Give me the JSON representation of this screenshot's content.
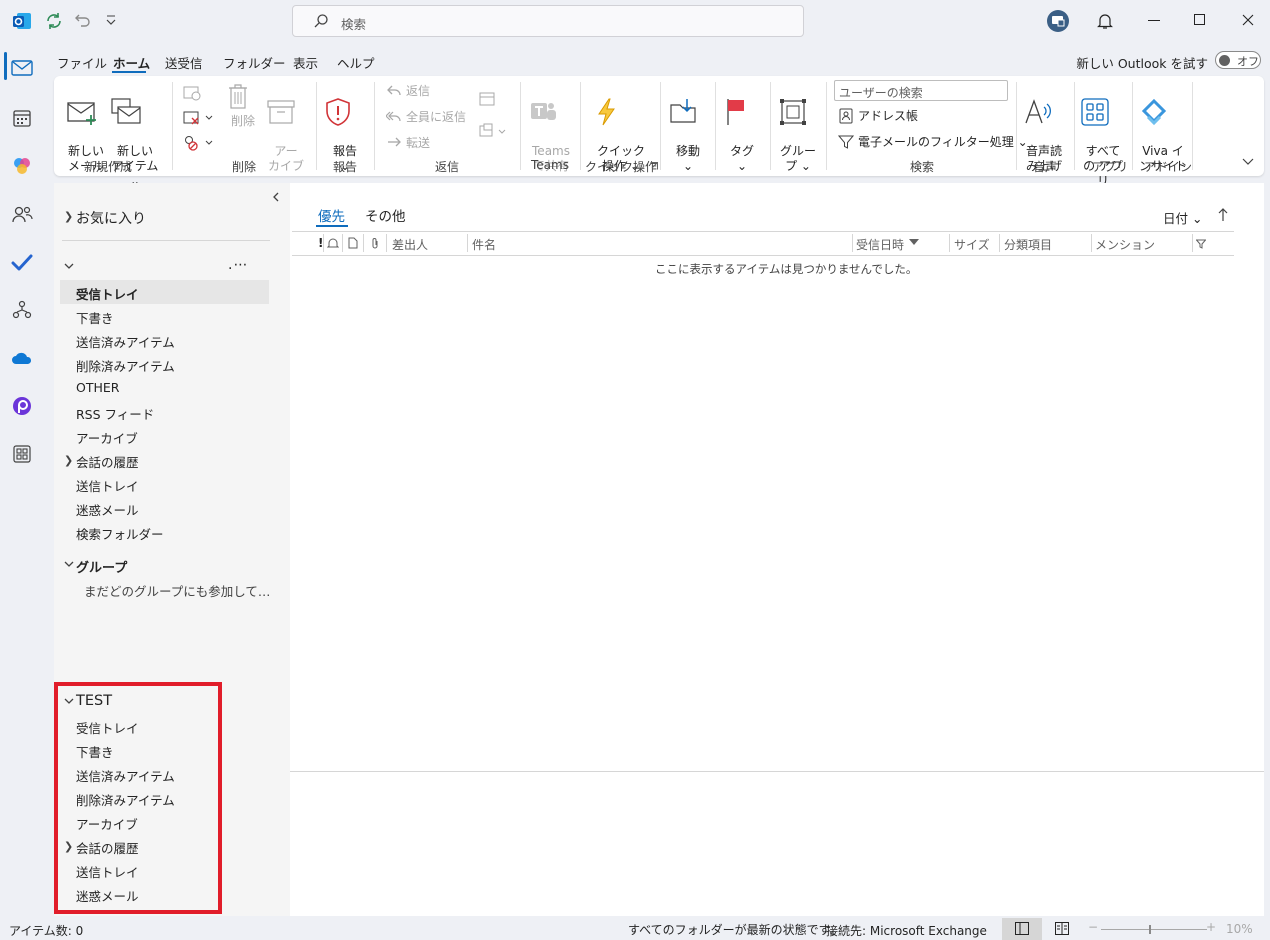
{
  "search": {
    "placeholder": "検索"
  },
  "menu": {
    "tabs": [
      "ファイル",
      "ホーム",
      "送受信",
      "フォルダー",
      "表示",
      "ヘルプ"
    ],
    "try_new_outlook": "新しい Outlook を試す",
    "toggle_label": "オフ"
  },
  "ribbon": {
    "new_mail": "新しい\nメール",
    "new_item": "新しい\nアイテム ⌄",
    "group_new": "新規作成",
    "delete": "削除",
    "archive": "アー\nカイブ",
    "group_delete": "削除",
    "report": "報告\n⌄",
    "group_report": "報告",
    "reply": "返信",
    "reply_all": "全員に返信",
    "forward": "転送",
    "group_respond": "返信",
    "teams_share": "Teams\nで共有",
    "group_teams": "Teams",
    "quick_steps": "クイック\n操作 ⌄",
    "group_quick": "クイック操作",
    "move": "移動\n⌄",
    "tags": "タグ\n⌄",
    "groups": "グルー\nプ ⌄",
    "search_people_placeholder": "ユーザーの検索",
    "address_book": "アドレス帳",
    "filter_email": "電子メールのフィルター処理 ⌄",
    "group_find": "検索",
    "read_aloud": "音声読\nみ上げ",
    "group_speech": "音声",
    "all_apps": "すべて\nの アプリ",
    "group_apps": "アプリ",
    "viva": "Viva イ\nンサイト",
    "group_addin": "アドイン"
  },
  "folders": {
    "favorites": "お気に入り",
    "main_account": [
      "受信トレイ",
      "下書き",
      "送信済みアイテム",
      "削除済みアイテム",
      "OTHER",
      "RSS フィード",
      "アーカイブ",
      "会話の履歴",
      "送信トレイ",
      "迷惑メール",
      "検索フォルダー"
    ],
    "groups_header": "グループ",
    "groups_empty": "まだどのグループにも参加して…",
    "test_header": "TEST",
    "test_account": [
      "受信トレイ",
      "下書き",
      "送信済みアイテム",
      "削除済みアイテム",
      "アーカイブ",
      "会話の履歴",
      "送信トレイ",
      "迷惑メール"
    ]
  },
  "list": {
    "tab_focused": "優先",
    "tab_other": "その他",
    "sort_label": "日付 ⌄",
    "columns": {
      "importance": "!",
      "from": "差出人",
      "subject": "件名",
      "received": "受信日時",
      "size": "サイズ",
      "categories": "分類項目",
      "mention": "メンション"
    },
    "empty_message": "ここに表示するアイテムは見つかりませんでした。"
  },
  "status": {
    "item_count": "アイテム数: 0",
    "sync_status": "すべてのフォルダーが最新の状態です。",
    "connection": "接続先: Microsoft Exchange",
    "zoom": "10%"
  },
  "colors": {
    "accent": "#0f6cbd",
    "highlight_box": "#e11d2a"
  }
}
